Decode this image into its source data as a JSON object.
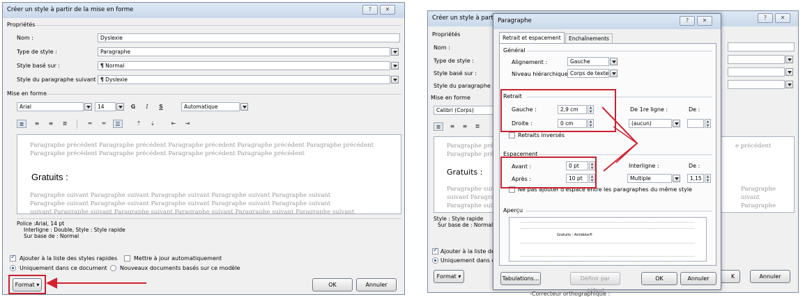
{
  "left_dialog": {
    "title": "Créer un style à partir de la mise en forme",
    "help": "?",
    "close": "✕",
    "props_label": "Propriétés",
    "nom_label": "Nom :",
    "nom_value": "Dyslexie",
    "type_label": "Type de style :",
    "type_value": "Paragraphe",
    "base_label": "Style basé sur :",
    "base_value": "Normal",
    "suivant_label": "Style du paragraphe suivant :",
    "suivant_value": "Dyslexie",
    "pilcrow": "¶",
    "format_label": "Mise en forme",
    "font": "Arial",
    "size": "14",
    "bold": "G",
    "italic": "I",
    "underline": "S",
    "color": "Automatique",
    "preview_prev": "Paragraphe précédent Paragraphe précédent Paragraphe précédent Paragraphe précédent Paragraphe précédent",
    "preview_prev2": "Paragraphe précédent Paragraphe précédent Paragraphe précédent Paragraphe précédent",
    "preview_sample": "Gratuits :",
    "preview_next": "Paragraphe suivant Paragraphe suivant Paragraphe suivant Paragraphe suivant Paragraphe suivant",
    "preview_next2": "Paragraphe suivant Paragraphe suivant Paragraphe suivant Paragraphe suivant Paragraphe suivant",
    "preview_next3": "suivant Paragraphe suivant Paragraphe suivant Paragraphe suivant Paragraphe suivant Paragraphe suivant",
    "desc_line1": "Police :Arial, 14 pt",
    "desc_line2": "Interligne : Double, Style : Style rapide",
    "desc_line3": "Sur base de : Normal",
    "add_quick": "Ajouter à la liste des styles rapides",
    "auto_update": "Mettre à jour automatiquement",
    "only_doc": "Uniquement dans ce document",
    "new_docs": "Nouveaux documents basés sur ce modèle",
    "format_btn": "Format ▾",
    "ok": "OK",
    "cancel": "Annuler"
  },
  "right_back_dialog": {
    "title": "Créer un style à partir de",
    "props_label": "Propriétés",
    "nom_label": "Nom :",
    "type_label": "Type de style :",
    "base_label": "Style basé sur :",
    "suivant_label": "Style du paragraphe sui",
    "format_label": "Mise en forme",
    "font": "Calibri (Corps)",
    "preview_prev": "Paragraphe préc",
    "preview_prev2": "Paragraphe préc",
    "preview_prev_right": "e précédent",
    "preview_sample": "Gratuits :",
    "preview_next": "Paragraphe suiv",
    "preview_next2": "suivant Paragra",
    "preview_next3": "Paragraphe suiv",
    "preview_next_r1": "Paragraphe",
    "preview_next_r2": "uivant",
    "preview_next_r3": "Paragraphe",
    "desc_line1": "Style : Style rapide",
    "desc_line2": "Sur base de : Normal",
    "add_quick": "Ajouter à la liste des s",
    "only_doc": "Uniquement dans ce d",
    "format_btn": "Format ▾",
    "ok_partial": "K",
    "cancel": "Annuler",
    "help": "?",
    "close": "✕"
  },
  "para_dialog": {
    "title": "Paragraphe",
    "help": "?",
    "close": "✕",
    "tab1": "Retrait et espacement",
    "tab2": "Enchaînements",
    "general": "Général",
    "align_label": "Alignement :",
    "align_value": "Gauche",
    "level_label": "Niveau hiérarchique :",
    "level_value": "Corps de texte",
    "retrait": "Retrait",
    "gauche_label": "Gauche :",
    "gauche_value": "2,9 cm",
    "droite_label": "Droite :",
    "droite_value": "0 cm",
    "first_line_label": "De 1re ligne :",
    "first_line_value": "(aucun)",
    "de_label": "De :",
    "mirror": "Retraits inversés",
    "espacement": "Espacement",
    "avant_label": "Avant :",
    "avant_value": "0 pt",
    "apres_label": "Après :",
    "apres_value": "10 pt",
    "interligne_label": "Interligne :",
    "interligne_value": "Multiple",
    "de2_label": "De :",
    "de2_value": "1,15",
    "no_space": "Ne pas ajouter d'espace entre les paragraphes du même style",
    "apercu": "Aperçu",
    "apercu_sample": "Gratuits : Antidote®",
    "tabs_btn": "Tabulations...",
    "default_btn": "Définir par défaut",
    "ok": "OK",
    "cancel": "Annuler"
  },
  "footer_text": "-Correcteur orthographique :"
}
